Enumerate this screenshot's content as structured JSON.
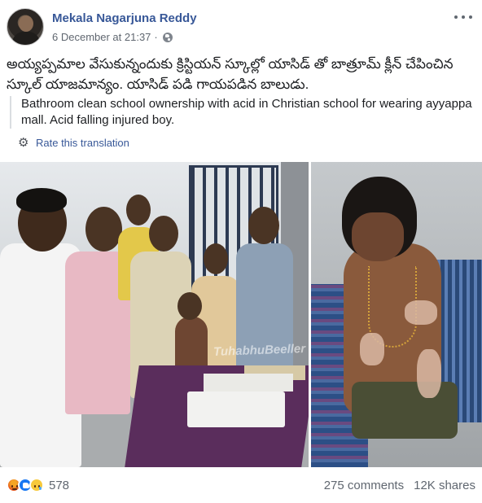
{
  "post": {
    "author": "Mekala Nagarjuna Reddy",
    "timestamp": "6 December at 21:37",
    "separator": "·",
    "privacy_icon": "globe-icon",
    "more_icon": "more-horizontal-icon",
    "body_text": "అయ్యప్పమాల వేసుకున్నందుకు క్రిస్టియన్ స్కూల్లో యాసిడ్ తో బాత్రూమ్ క్లీన్ చేపించిన స్కూల్ యాజమాన్యం. యాసిడ్ పడి గాయపడిన బాలుడు.",
    "translation_text": "Bathroom clean school ownership with acid in Christian school for wearing ayyappa mall. Acid falling injured boy.",
    "rate_translation": "Rate this translation",
    "photo_watermark": "TuhabhuBeeller"
  },
  "footer": {
    "reaction_icons": [
      "angry-icon",
      "like-icon",
      "sad-icon"
    ],
    "reaction_count": "578",
    "comments": "275 comments",
    "shares": "12K shares"
  },
  "colors": {
    "link": "#385898",
    "secondary_text": "#606770",
    "like_blue": "#1877f2"
  }
}
